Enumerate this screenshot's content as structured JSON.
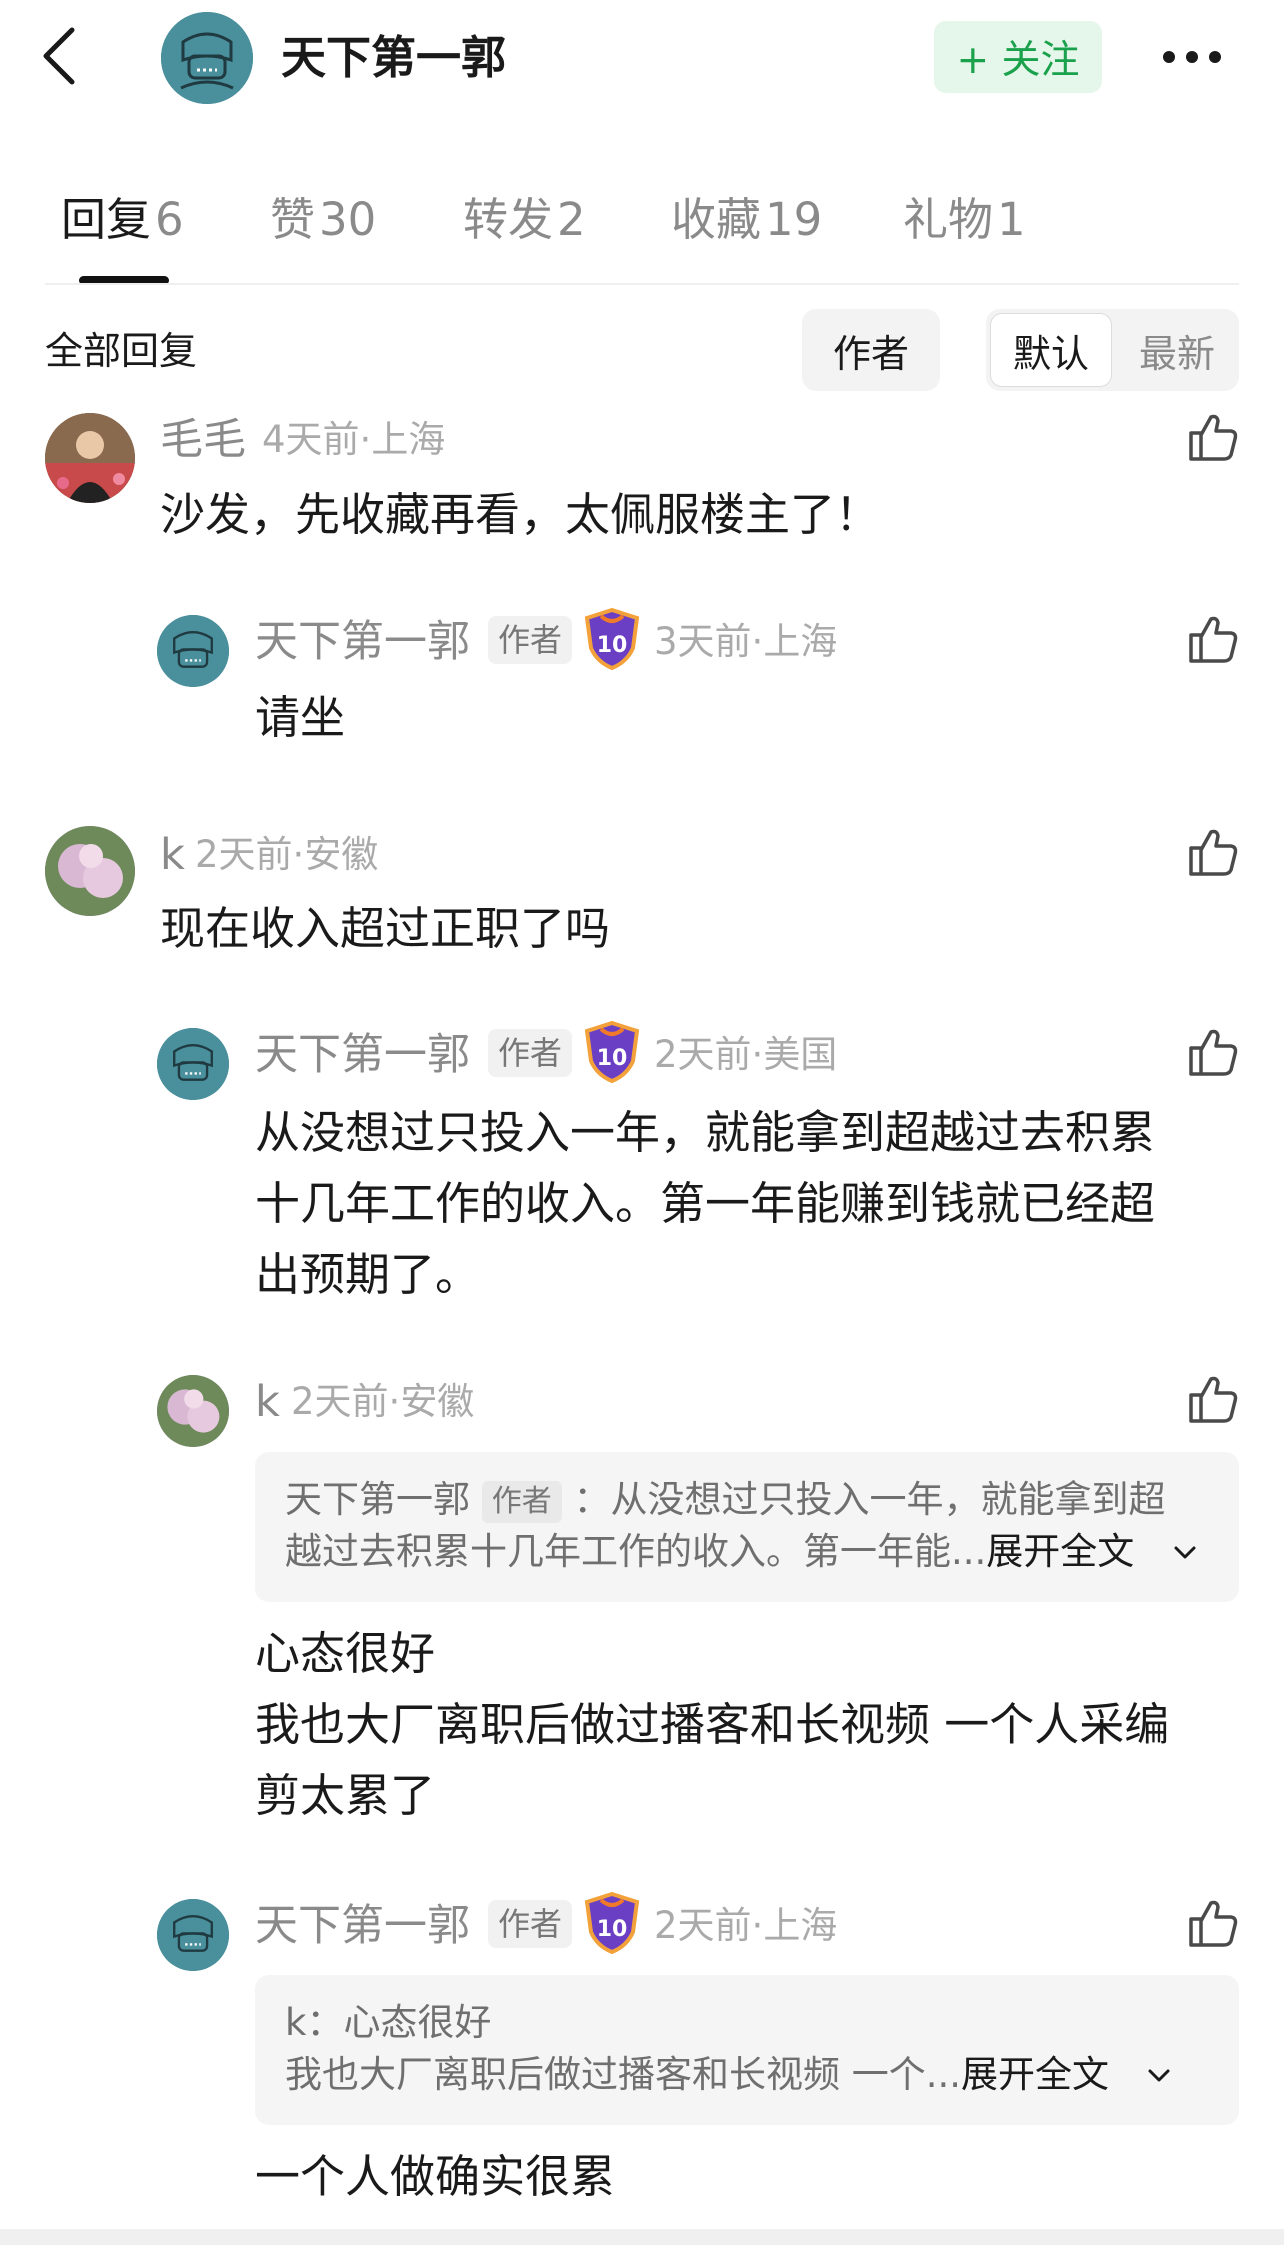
{
  "header": {
    "back_icon": "chevron-left-icon",
    "name": "天下第一郭",
    "follow_label": "+ 关注",
    "more_icon": "more-horizontal-icon",
    "accent": "#1aa14c"
  },
  "tabs": [
    {
      "label": "回复",
      "count": "6",
      "active": true
    },
    {
      "label": "赞",
      "count": "30"
    },
    {
      "label": "转发",
      "count": "2"
    },
    {
      "label": "收藏",
      "count": "19"
    },
    {
      "label": "礼物",
      "count": "1"
    }
  ],
  "filter": {
    "section_label": "全部回复",
    "author_label": "作者",
    "sort_default": "默认",
    "sort_latest": "最新"
  },
  "comments": [
    {
      "user": "毛毛",
      "time": "4天前",
      "location": "上海",
      "text": "沙发，先收藏再看，太佩服楼主了！"
    },
    {
      "user": "天下第一郭",
      "tag": "作者",
      "level": "10",
      "time": "3天前",
      "location": "上海",
      "text": "请坐"
    },
    {
      "user": "k",
      "time": "2天前",
      "location": "安徽",
      "text": "现在收入超过正职了吗"
    },
    {
      "user": "天下第一郭",
      "tag": "作者",
      "level": "10",
      "time": "2天前",
      "location": "美国",
      "lines": [
        "从没想过只投入一年，就能拿到超越过去积累",
        "十几年工作的收入。第一年能赚到钱就已经超",
        "出预期了。"
      ]
    },
    {
      "user": "k",
      "time": "2天前",
      "location": "安徽",
      "quote": {
        "user": "天下第一郭",
        "tag": "作者",
        "line1": "从没想过只投入一年，就能拿到超",
        "line2": "越过去积累十几年工作的收入。第一年能..."
      },
      "lines": [
        "心态很好",
        "我也大厂离职后做过播客和长视频 一个人采编",
        "剪太累了"
      ]
    },
    {
      "user": "天下第一郭",
      "tag": "作者",
      "level": "10",
      "time": "2天前",
      "location": "上海",
      "quote": {
        "user": "k",
        "line1": "心态很好",
        "line2": "我也大厂离职后做过播客和长视频 一个..."
      },
      "text": "一个人做确实很累"
    }
  ],
  "expand_label": "展开全文",
  "separator": "·",
  "quote_colon": "：",
  "like_icon": "thumbs-up-icon"
}
